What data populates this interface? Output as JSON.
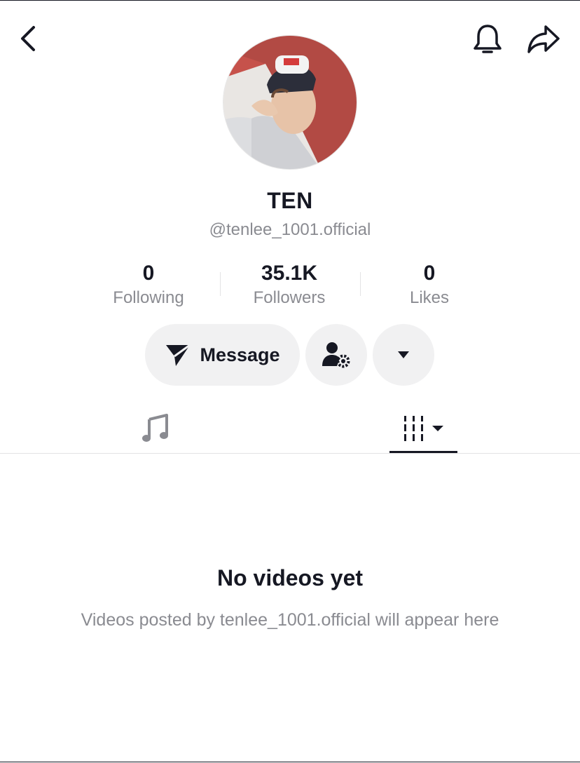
{
  "header": {
    "back_icon": "chevron-left-icon",
    "bell_icon": "bell-icon",
    "share_icon": "share-arrow-icon"
  },
  "profile": {
    "name": "TEN",
    "handle": "@tenlee_1001.official",
    "avatar_icon": "profile-photo"
  },
  "stats": [
    {
      "value": "0",
      "label": "Following"
    },
    {
      "value": "35.1K",
      "label": "Followers"
    },
    {
      "value": "0",
      "label": "Likes"
    }
  ],
  "actions": {
    "message_label": "Message",
    "message_icon": "send-plane-icon",
    "friends_icon": "person-settings-icon",
    "more_icon": "caret-down-icon"
  },
  "tabs": {
    "music_icon": "music-note-icon",
    "videos_icon": "grid-sort-icon"
  },
  "empty_state": {
    "title": "No videos yet",
    "subtitle": "Videos posted by tenlee_1001.official will appear here"
  },
  "colors": {
    "text_primary": "#161823",
    "text_secondary": "#8a8b91",
    "button_bg": "#f1f1f2"
  }
}
